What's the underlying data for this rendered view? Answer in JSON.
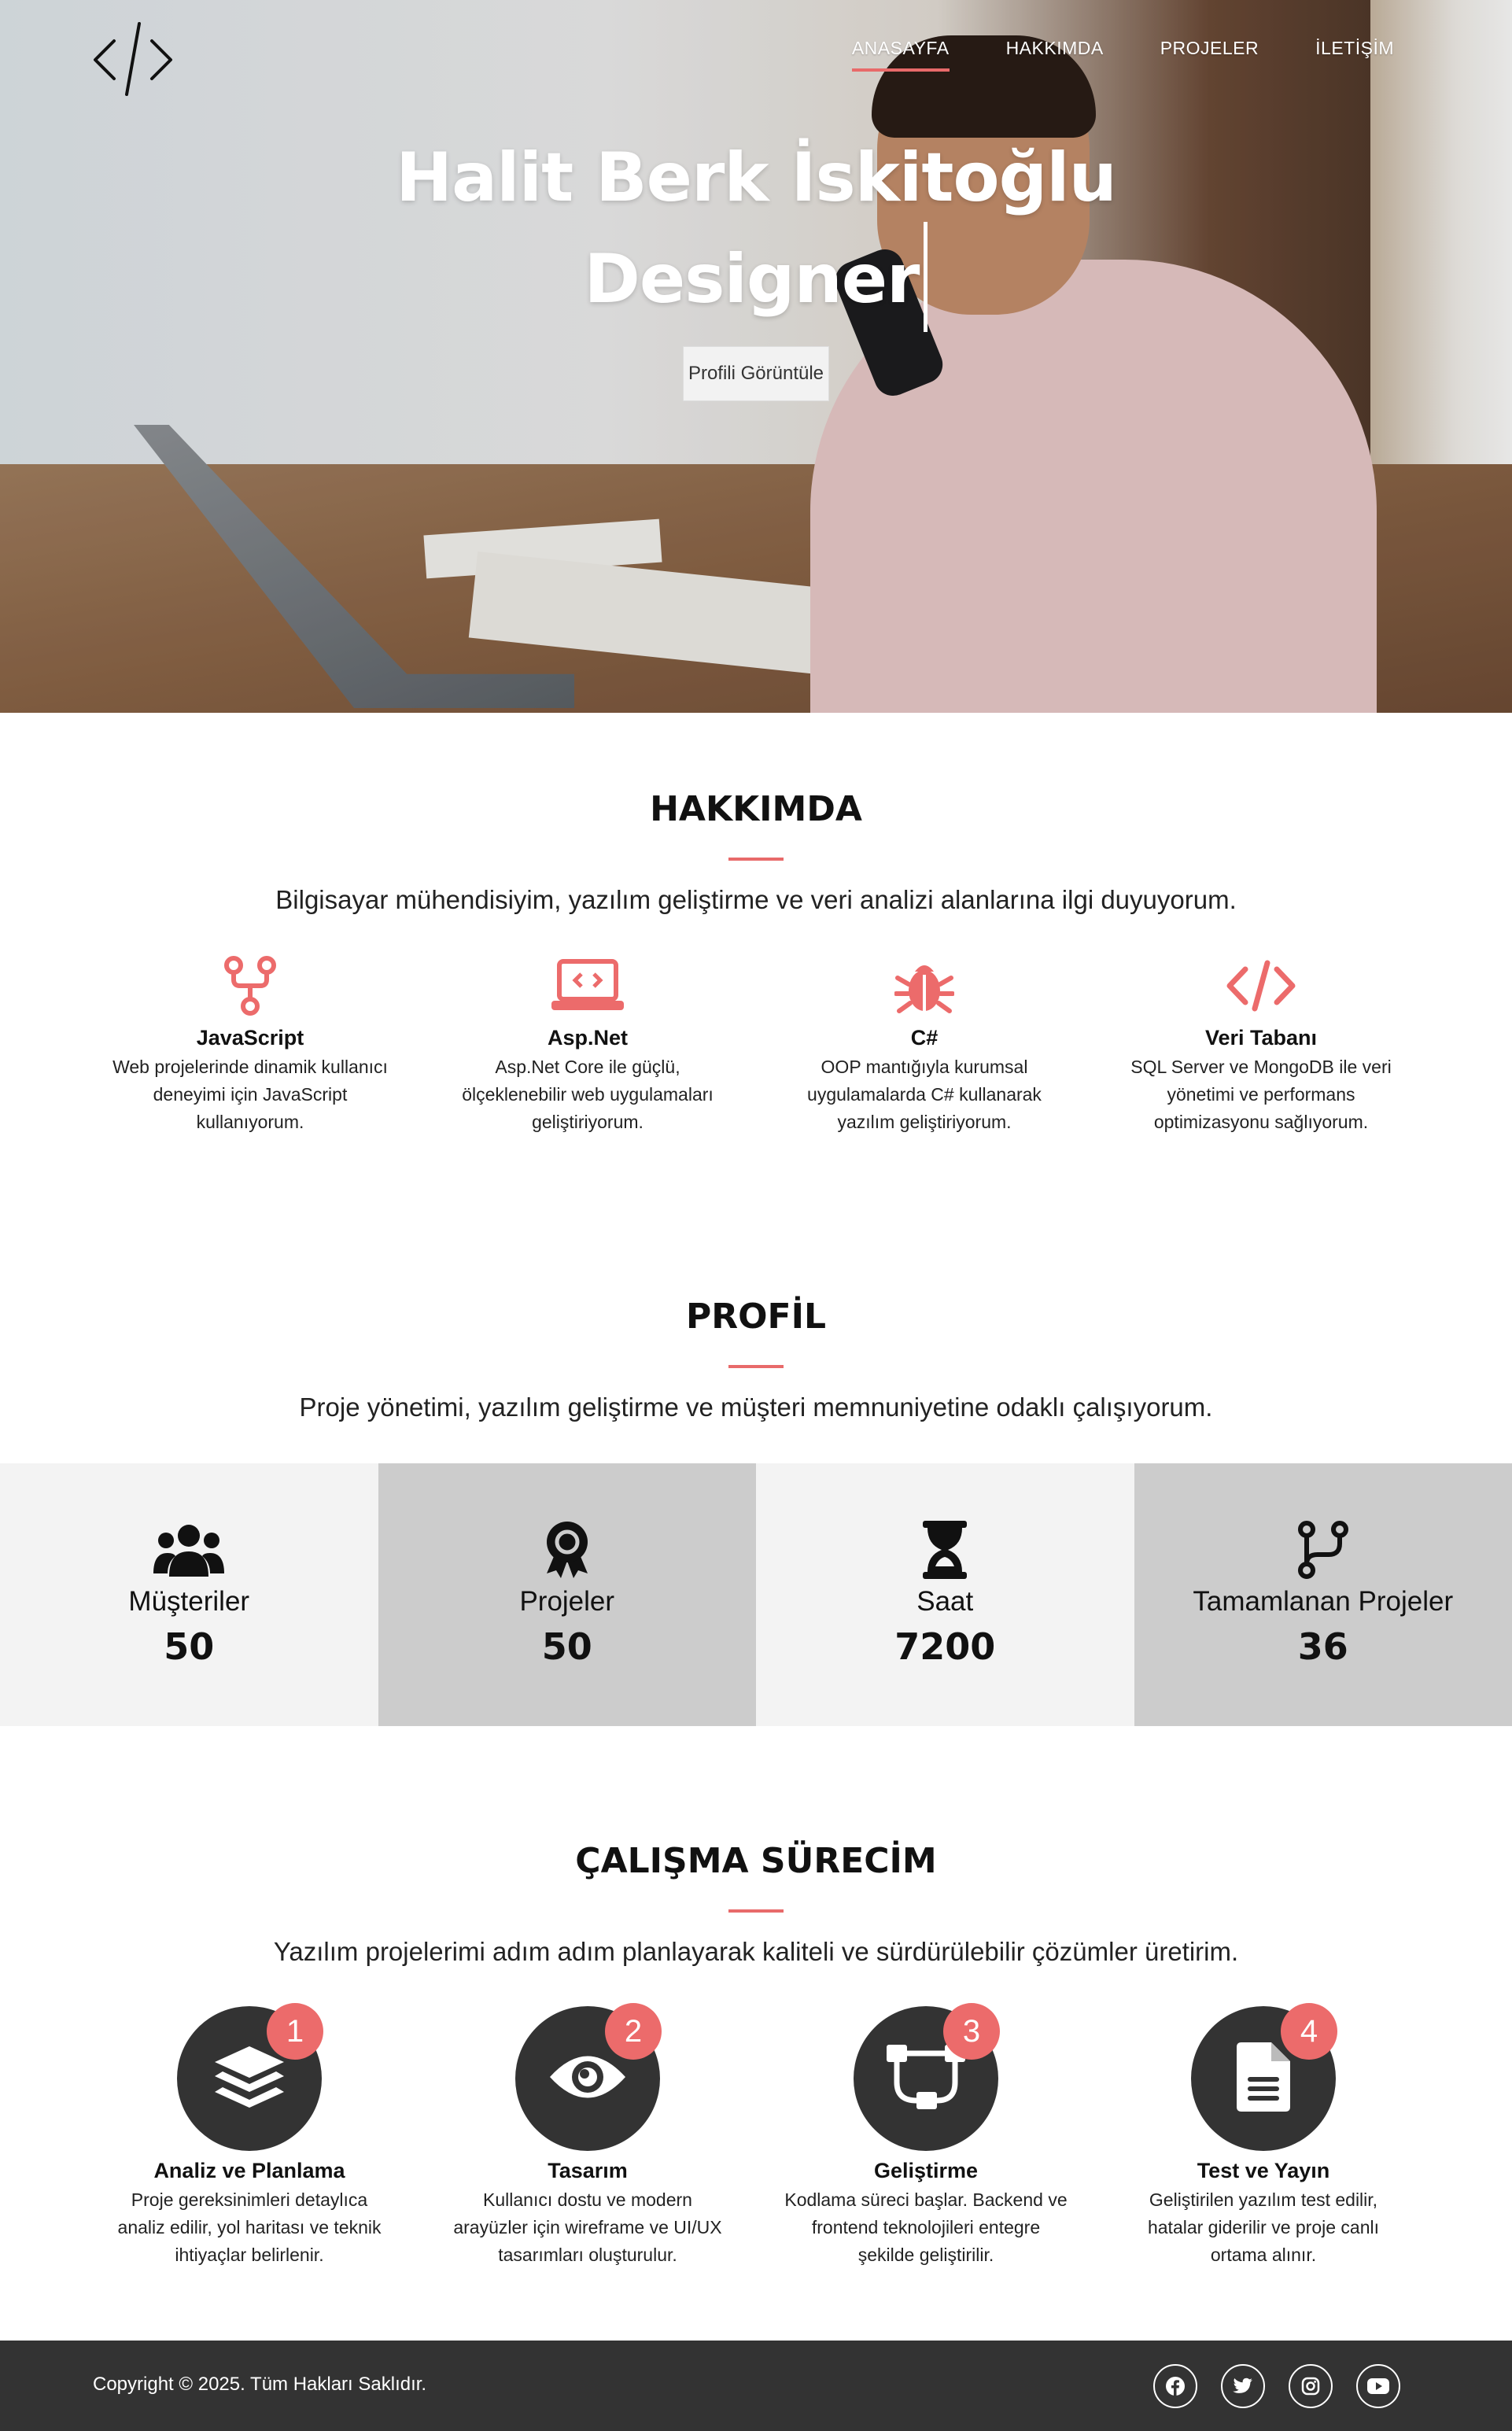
{
  "nav": {
    "items": [
      {
        "label": "ANASAYFA",
        "active": true
      },
      {
        "label": "HAKKIMDA",
        "active": false
      },
      {
        "label": "PROJELER",
        "active": false
      },
      {
        "label": "İLETİŞİM",
        "active": false
      }
    ],
    "logo_icon": "code-brackets-icon"
  },
  "hero": {
    "name": "Halit Berk İskitoğlu",
    "role": "Designer",
    "button_label": "Profili Görüntüle"
  },
  "about": {
    "title": "HAKKIMDA",
    "subtitle": "Bilgisayar mühendisiyim, yazılım geliştirme ve veri analizi alanlarına ilgi duyuyorum.",
    "skills": [
      {
        "icon": "code-fork-icon",
        "title": "JavaScript",
        "lines": [
          "Web projelerinde dinamik kullanıcı",
          "deneyimi için JavaScript",
          "kullanıyorum."
        ]
      },
      {
        "icon": "laptop-code-icon",
        "title": "Asp.Net",
        "lines": [
          "Asp.Net Core ile güçlü,",
          "ölçeklenebilir web uygulamaları",
          "geliştiriyorum."
        ]
      },
      {
        "icon": "bug-icon",
        "title": "C#",
        "lines": [
          "OOP mantığıyla kurumsal",
          "uygulamalarda C# kullanarak",
          "yazılım geliştiriyorum."
        ]
      },
      {
        "icon": "code-icon",
        "title": "Veri Tabanı",
        "lines": [
          "SQL Server ve MongoDB ile veri",
          "yönetimi ve performans",
          "optimizasyonu sağlıyorum."
        ]
      }
    ]
  },
  "profile": {
    "title": "PROFİL",
    "subtitle": "Proje yönetimi, yazılım geliştirme ve müşteri memnuniyetine odaklı çalışıyorum.",
    "stats": [
      {
        "icon": "users-icon",
        "label": "Müşteriler",
        "value": "50"
      },
      {
        "icon": "award-icon",
        "label": "Projeler",
        "value": "50"
      },
      {
        "icon": "hourglass-icon",
        "label": "Saat",
        "value": "7200"
      },
      {
        "icon": "code-branch-icon",
        "label": "Tamamlanan Projeler",
        "value": "36"
      }
    ]
  },
  "process": {
    "title": "ÇALIŞMA SÜRECİM",
    "subtitle": "Yazılım projelerimi adım adım planlayarak kaliteli ve sürdürülebilir çözümler üretirim.",
    "steps": [
      {
        "number": "1",
        "icon": "layers-icon",
        "title": "Analiz ve Planlama",
        "lines": [
          "Proje gereksinimleri detaylıca",
          "analiz edilir, yol haritası ve teknik",
          "ihtiyaçlar belirlenir."
        ]
      },
      {
        "number": "2",
        "icon": "eye-icon",
        "title": "Tasarım",
        "lines": [
          "Kullanıcı dostu ve modern",
          "arayüzler için wireframe ve UI/UX",
          "tasarımları oluşturulur."
        ]
      },
      {
        "number": "3",
        "icon": "project-diagram-icon",
        "title": "Geliştirme",
        "lines": [
          "Kodlama süreci başlar. Backend ve",
          "frontend teknolojileri entegre",
          "şekilde geliştirilir."
        ]
      },
      {
        "number": "4",
        "icon": "file-icon",
        "title": "Test ve Yayın",
        "lines": [
          "Geliştirilen yazılım test edilir,",
          "hatalar giderilir ve proje canlı",
          "ortama alınır."
        ]
      }
    ]
  },
  "footer": {
    "copyright": "Copyright © 2025. Tüm Hakları Saklıdır.",
    "socials": [
      "facebook-icon",
      "twitter-icon",
      "instagram-icon",
      "youtube-icon"
    ]
  },
  "colors": {
    "accent": "#ec6b6b",
    "dark": "#333333",
    "stat_light": "#f3f3f3",
    "stat_dark": "#cccccc"
  }
}
